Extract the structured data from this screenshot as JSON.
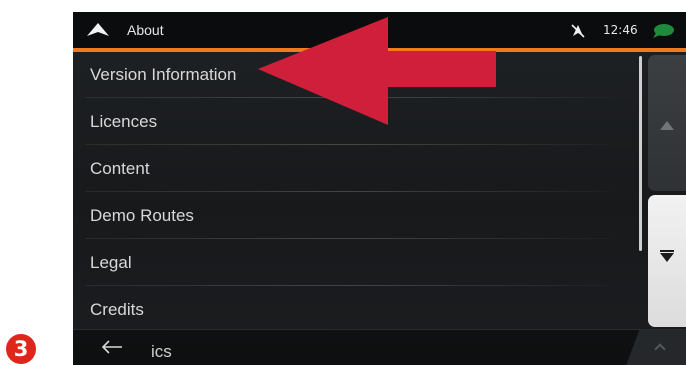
{
  "step": {
    "number": "3"
  },
  "header": {
    "title": "About",
    "time": "12:46",
    "icons": [
      "navigation-arrow-icon",
      "no-gps-signal-icon",
      "message-bubble-icon"
    ]
  },
  "menu": {
    "items": [
      {
        "label": "Version Information"
      },
      {
        "label": "Licences"
      },
      {
        "label": "Content"
      },
      {
        "label": "Demo Routes"
      },
      {
        "label": "Legal"
      },
      {
        "label": "Credits"
      }
    ]
  },
  "bottom": {
    "partial_label": "ics",
    "icons": [
      "back-arrow-icon",
      "chevron-up-icon"
    ]
  },
  "scroll": {
    "icons": [
      "scroll-up-icon",
      "scroll-down-icon"
    ]
  },
  "colors": {
    "accent_orange": "#f07a1c",
    "callout_red": "#d01f3a",
    "badge_red": "#e0261b",
    "background": "#1c1e21"
  }
}
